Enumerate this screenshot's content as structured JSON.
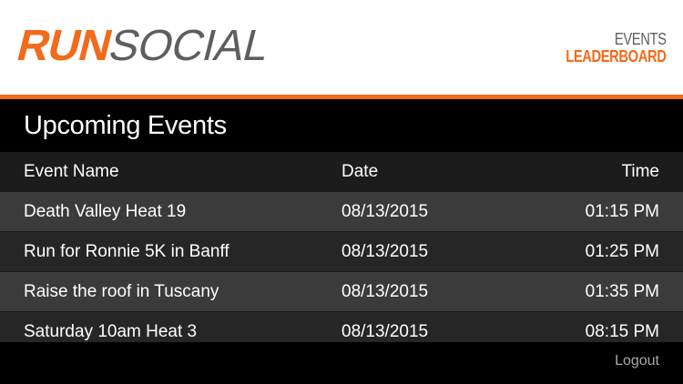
{
  "brand": {
    "run": "RUN",
    "social": "SOCIAL"
  },
  "nav": {
    "events_label": "EVENTS",
    "leaderboard_label": "LEADERBOARD"
  },
  "page": {
    "title": "Upcoming Events"
  },
  "table": {
    "headers": {
      "name": "Event Name",
      "date": "Date",
      "time": "Time"
    },
    "rows": [
      {
        "name": "Death Valley Heat 19",
        "date": "08/13/2015",
        "time": "01:15 PM"
      },
      {
        "name": "Run for Ronnie 5K in Banff",
        "date": "08/13/2015",
        "time": "01:25 PM"
      },
      {
        "name": "Raise the roof in Tuscany",
        "date": "08/13/2015",
        "time": "01:35 PM"
      },
      {
        "name": "Saturday 10am Heat 3",
        "date": "08/13/2015",
        "time": "08:15 PM"
      }
    ]
  },
  "footer": {
    "logout_label": "Logout"
  },
  "colors": {
    "accent": "#f26a1b",
    "brand_gray": "#5e5e5e",
    "row_light": "#3b3b3b",
    "row_dark": "#262626"
  }
}
